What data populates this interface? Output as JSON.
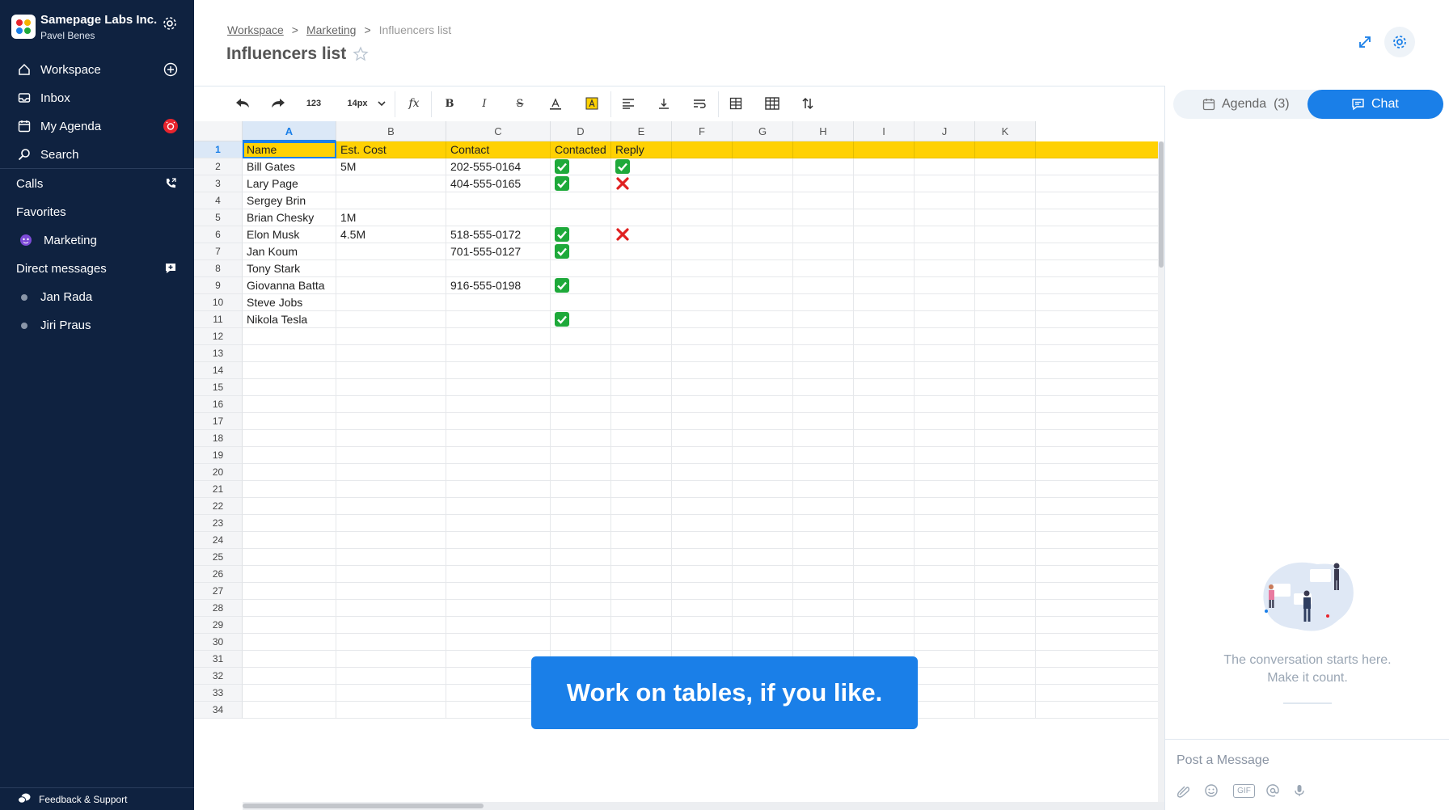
{
  "org": {
    "name": "Samepage Labs Inc.",
    "user": "Pavel Benes"
  },
  "sidebar": {
    "workspace": "Workspace",
    "inbox": "Inbox",
    "agenda": "My Agenda",
    "search": "Search",
    "calls": "Calls",
    "favorites": "Favorites",
    "favorite_items": [
      "Marketing"
    ],
    "direct_messages": "Direct messages",
    "dm_items": [
      "Jan Rada",
      "Jiri Praus"
    ],
    "feedback": "Feedback & Support"
  },
  "breadcrumbs": {
    "workspace": "Workspace",
    "marketing": "Marketing",
    "current": "Influencers list"
  },
  "page": {
    "title": "Influencers list"
  },
  "toolbar": {
    "number_format": "123",
    "font_size": "14px",
    "function": "fx",
    "bold": "B",
    "italic": "I",
    "strike": "S"
  },
  "sheet": {
    "columns": [
      "A",
      "B",
      "C",
      "D",
      "E",
      "F",
      "G",
      "H",
      "I",
      "J",
      "K"
    ],
    "header": [
      "Name",
      "Est. Cost",
      "Contact",
      "Contacted",
      "Reply"
    ],
    "rows": [
      {
        "name": "Bill Gates",
        "cost": "5M",
        "contact": "202-555-0164",
        "contacted": "check",
        "reply": "check"
      },
      {
        "name": "Lary Page",
        "cost": "",
        "contact": "404-555-0165",
        "contacted": "check",
        "reply": "x"
      },
      {
        "name": "Sergey Brin",
        "cost": "",
        "contact": "",
        "contacted": "",
        "reply": ""
      },
      {
        "name": "Brian Chesky",
        "cost": "1M",
        "contact": "",
        "contacted": "",
        "reply": ""
      },
      {
        "name": "Elon Musk",
        "cost": "4.5M",
        "contact": "518-555-0172",
        "contacted": "check",
        "reply": "x"
      },
      {
        "name": "Jan Koum",
        "cost": "",
        "contact": "701-555-0127",
        "contacted": "check",
        "reply": ""
      },
      {
        "name": "Tony Stark",
        "cost": "",
        "contact": "",
        "contacted": "",
        "reply": ""
      },
      {
        "name": "Giovanna Batta",
        "cost": "",
        "contact": "916-555-0198",
        "contacted": "check",
        "reply": ""
      },
      {
        "name": "Steve Jobs",
        "cost": "",
        "contact": "",
        "contacted": "",
        "reply": ""
      },
      {
        "name": "Nikola Tesla",
        "cost": "",
        "contact": "",
        "contacted": "check",
        "reply": ""
      }
    ],
    "row_numbers": [
      "1",
      "2",
      "3",
      "4",
      "5",
      "6",
      "7",
      "8",
      "9",
      "10",
      "11",
      "12",
      "13",
      "14",
      "15",
      "16",
      "17",
      "18",
      "19",
      "20",
      "21",
      "22",
      "23",
      "24",
      "25",
      "26",
      "27",
      "28",
      "29",
      "30",
      "31",
      "32",
      "33",
      "34"
    ],
    "header_color": "#ffd103",
    "selection_color": "#1a7fe8"
  },
  "banner": {
    "text": "Work on tables, if you like."
  },
  "panel": {
    "agenda_label": "Agenda",
    "agenda_count": "(3)",
    "chat_label": "Chat",
    "empty_line1": "The conversation starts here.",
    "empty_line2": "Make it count.",
    "compose_placeholder": "Post a Message",
    "gif_label": "GIF"
  },
  "colors": {
    "sidebar": "#0f2240",
    "accent": "#1a7fe8",
    "badge": "#e8242d",
    "check": "#1ea93a",
    "cross": "#e02020"
  }
}
